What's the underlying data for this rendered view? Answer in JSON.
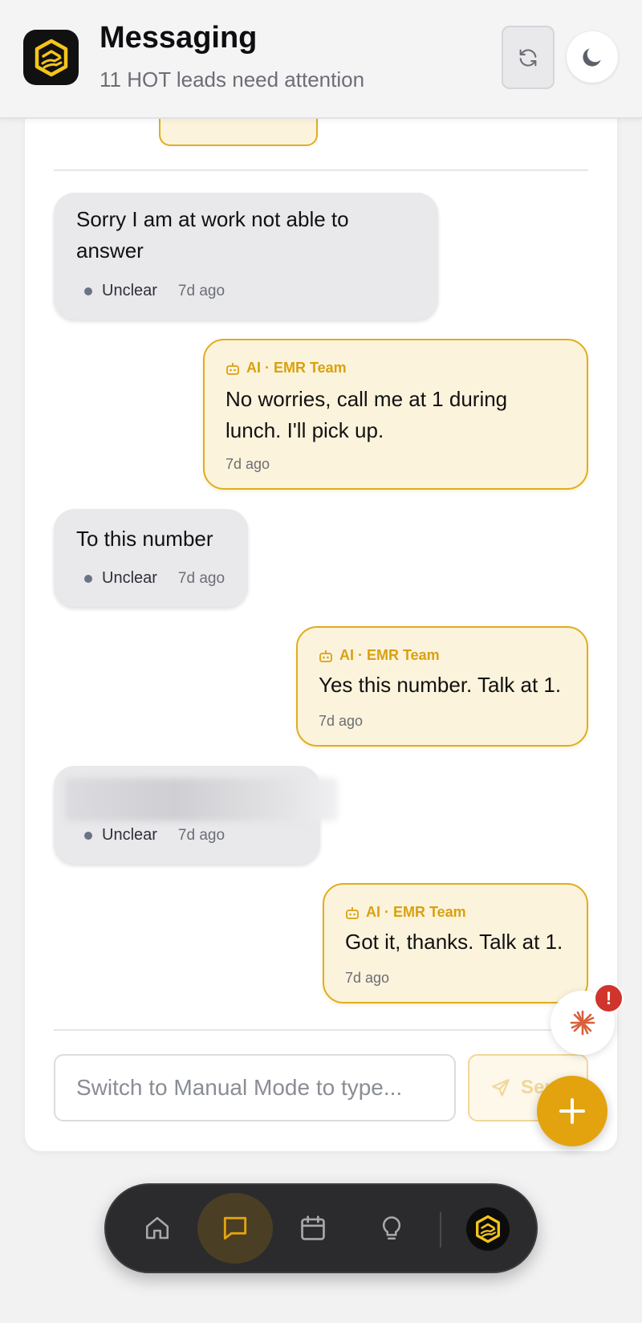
{
  "header": {
    "title": "Messaging",
    "subtitle": "11 HOT leads need attention"
  },
  "messages": [
    {
      "direction": "incoming",
      "text_lines": [
        "Sorry I am at work not able to",
        "answer"
      ],
      "status": "Unclear",
      "time": "7d ago"
    },
    {
      "direction": "outgoing",
      "sender": "AI · EMR Team",
      "text_lines": [
        "No worries, call me at 1 during",
        "lunch. I'll pick up."
      ],
      "time": "7d ago"
    },
    {
      "direction": "incoming",
      "text_lines": [
        "To this number"
      ],
      "status": "Unclear",
      "time": "7d ago"
    },
    {
      "direction": "outgoing",
      "sender": "AI · EMR Team",
      "text_lines": [
        "Yes this number. Talk at 1."
      ],
      "time": "7d ago"
    },
    {
      "direction": "incoming",
      "text_lines": [],
      "redacted": true,
      "status": "Unclear",
      "time": "7d ago"
    },
    {
      "direction": "outgoing",
      "sender": "AI · EMR Team",
      "text_lines": [
        "Got it, thanks. Talk at 1."
      ],
      "time": "7d ago"
    }
  ],
  "composer": {
    "placeholder": "Switch to Manual Mode to type...",
    "send_label": "Send"
  },
  "alert_badge": "!",
  "colors": {
    "accent": "#e3a30f",
    "ai_bubble_bg": "#fcf3dc",
    "ai_bubble_border": "#e0ad1e",
    "incoming_bubble_bg": "#e9e9ec",
    "alert": "#d0342c",
    "nav_bg": "#2b2b2d"
  },
  "icons": {
    "app_logo": "house-hand-logo",
    "refresh": "refresh-icon",
    "theme": "moon-icon",
    "sender": "robot-icon",
    "send": "paper-plane-icon",
    "ai_assistant": "sparkle-icon",
    "add": "plus-icon",
    "nav": [
      "home-icon",
      "message-icon",
      "calendar-icon",
      "lightbulb-icon",
      "brand-logo"
    ]
  },
  "nav": {
    "active": "message-icon"
  }
}
